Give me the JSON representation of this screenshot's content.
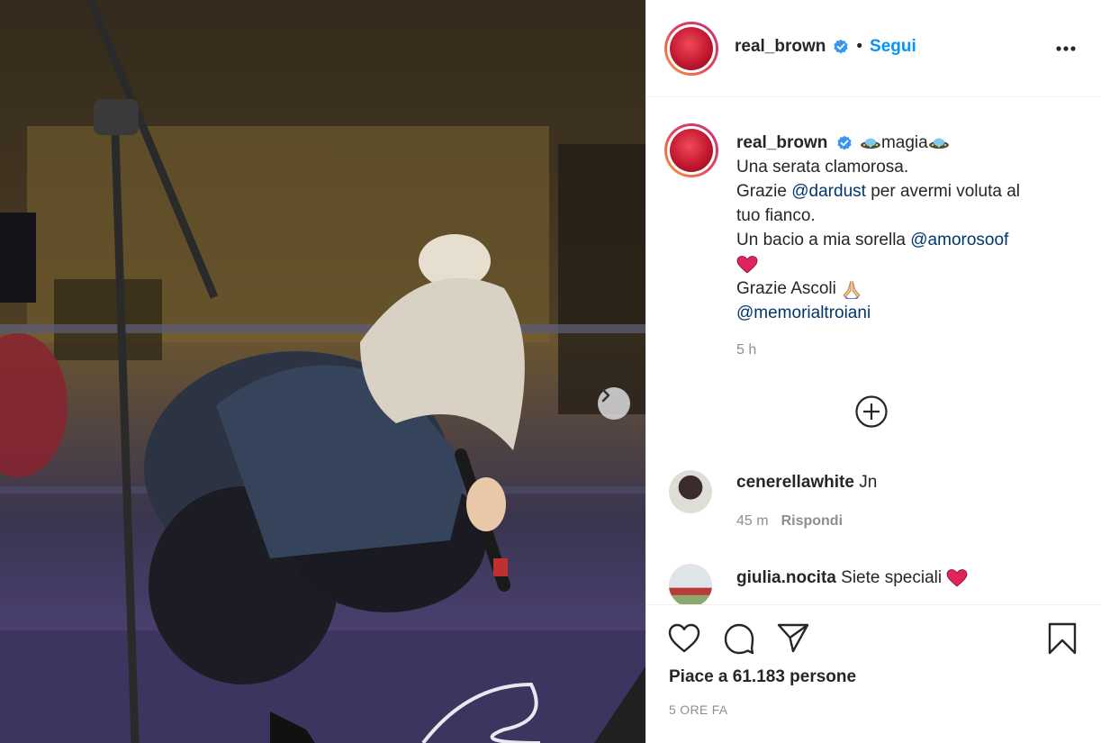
{
  "post": {
    "username": "real_brown",
    "follow_label": "Segui",
    "more_icon": "more-options-icon"
  },
  "caption": {
    "username": "real_brown",
    "line1_text": "magia",
    "line2": "Una serata clamorosa.",
    "line3_pre": "Grazie ",
    "line3_mention": "@dardust",
    "line3_post": " per avermi voluta al",
    "line4": "tuo fianco.",
    "line5_pre": "Un bacio a mia sorella ",
    "line5_mention": "@amorosoof",
    "line7": "Grazie Ascoli ",
    "line8_mention": "@memorialtroiani",
    "time": "5 h"
  },
  "comments": [
    {
      "username": "cenerellawhite",
      "text": "Jn",
      "time": "45 m",
      "reply": "Rispondi"
    },
    {
      "username": "giulia.nocita",
      "text": "Siete speciali"
    }
  ],
  "footer": {
    "likes": "Piace a 61.183 persone",
    "date": "5 ORE FA"
  },
  "colors": {
    "link_blue": "#0095f6",
    "mention": "#00376b",
    "verified": "#3897f0",
    "heart_red": "#e0245e"
  }
}
